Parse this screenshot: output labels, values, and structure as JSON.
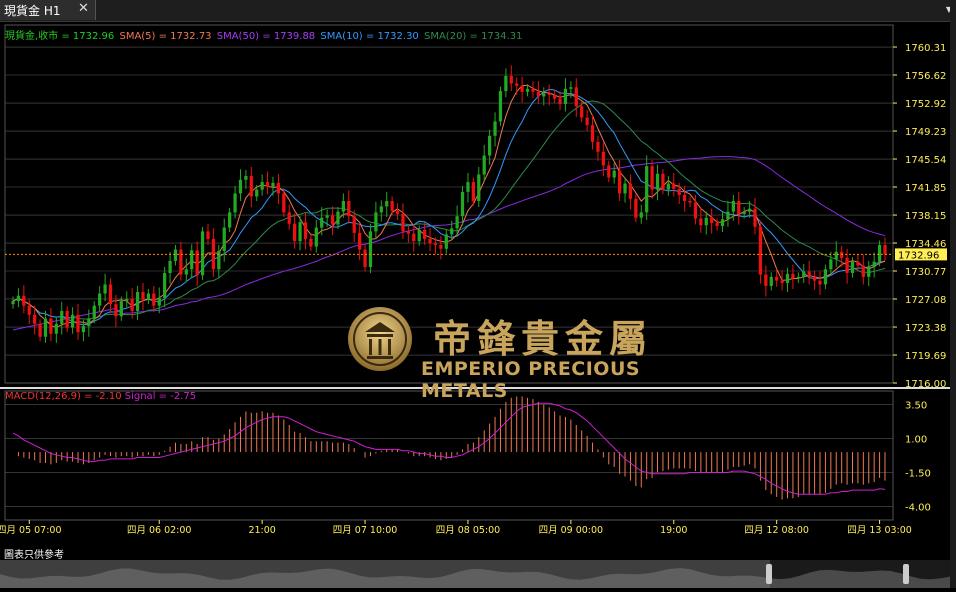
{
  "tab": {
    "title": "現貨金 H1",
    "close": "✕",
    "menu": "▼"
  },
  "legend": {
    "price": "現貨金,收市 = 1732.96",
    "sma5": "SMA(5) = 1732.73",
    "sma50": "SMA(50) = 1739.88",
    "sma10": "SMA(10) = 1732.30",
    "sma20": "SMA(20) = 1734.31"
  },
  "macd_legend": {
    "label": "MACD(12,26,9) = -2.10",
    "signal": "Signal = -2.75"
  },
  "current_price_label": "1732.96",
  "logo": {
    "chinese": "帝鋒貴金屬",
    "english": "EMPERIO PRECIOUS METALS"
  },
  "disclaimer": "圖表只供參考",
  "colors": {
    "bull": "#22aa22",
    "bear": "#ee1111",
    "sma5": "#f07850",
    "sma10": "#3399ff",
    "sma20": "#2d8a4e",
    "sma50": "#8a2be2",
    "macd_hist": "#f07850",
    "signal": "#d020d0",
    "axis_text": "#ffee55",
    "current_line": "#ff8c00",
    "gold": "#c9a45c"
  },
  "chart_data": [
    {
      "type": "candlestick",
      "title": "現貨金 H1",
      "yaxis_ticks": [
        1760.31,
        1756.62,
        1752.92,
        1749.23,
        1745.54,
        1741.85,
        1738.15,
        1734.46,
        1730.77,
        1727.08,
        1723.38,
        1719.69,
        1716.0
      ],
      "ylim": [
        1716.0,
        1761.5
      ],
      "xaxis_ticks": [
        "四月 05 07:00",
        "四月 06 02:00",
        "21:00",
        "四月 07 10:00",
        "四月 08 05:00",
        "四月 09 00:00",
        "19:00",
        "四月 12 08:00",
        "四月 13 03:00"
      ],
      "xtick_bar_index": [
        3,
        27,
        46,
        65,
        84,
        103,
        122,
        141,
        160
      ],
      "grid": true,
      "current_price": 1732.96,
      "series": [
        {
          "name": "現貨金",
          "close": [
            1726.8,
            1727.5,
            1726.2,
            1725.0,
            1723.8,
            1722.1,
            1724.5,
            1722.5,
            1723.8,
            1725.5,
            1723.3,
            1725.0,
            1722.7,
            1723.5,
            1724.5,
            1726.2,
            1727.8,
            1729.0,
            1726.4,
            1724.8,
            1726.8,
            1727.1,
            1725.5,
            1728.0,
            1727.0,
            1727.8,
            1726.2,
            1727.2,
            1730.5,
            1732.1,
            1733.6,
            1730.3,
            1731.0,
            1733.5,
            1730.2,
            1736.0,
            1735.0,
            1731.0,
            1733.4,
            1736.5,
            1738.5,
            1741.0,
            1742.8,
            1743.3,
            1740.6,
            1741.5,
            1742.5,
            1741.9,
            1742.4,
            1741.0,
            1738.5,
            1737.0,
            1734.7,
            1737.2,
            1735.0,
            1734.0,
            1736.5,
            1737.8,
            1738.1,
            1736.9,
            1738.6,
            1740.0,
            1738.0,
            1735.8,
            1733.6,
            1731.3,
            1736.0,
            1738.5,
            1739.3,
            1740.0,
            1738.7,
            1738.3,
            1736.0,
            1735.7,
            1734.7,
            1736.2,
            1735.0,
            1734.4,
            1734.2,
            1733.7,
            1735.6,
            1736.4,
            1738.0,
            1741.2,
            1742.5,
            1740.0,
            1743.5,
            1746.0,
            1748.6,
            1750.5,
            1754.5,
            1756.5,
            1755.5,
            1755.2,
            1754.4,
            1754.8,
            1754.4,
            1753.8,
            1754.2,
            1754.0,
            1753.5,
            1752.8,
            1754.8,
            1755.0,
            1752.5,
            1751.0,
            1750.0,
            1747.8,
            1746.5,
            1744.7,
            1743.1,
            1744.0,
            1741.0,
            1742.3,
            1740.3,
            1737.8,
            1738.5,
            1744.6,
            1741.5,
            1743.6,
            1741.5,
            1742.3,
            1741.6,
            1740.8,
            1740.0,
            1739.8,
            1737.7,
            1736.8,
            1737.8,
            1737.1,
            1736.7,
            1737.6,
            1738.6,
            1740.0,
            1738.3,
            1738.6,
            1739.0,
            1736.6,
            1730.3,
            1728.8,
            1730.0,
            1729.5,
            1729.2,
            1730.4,
            1729.8,
            1730.0,
            1730.7,
            1730.0,
            1729.5,
            1729.0,
            1731.0,
            1732.3,
            1733.3,
            1732.5,
            1730.5,
            1732.0,
            1731.5,
            1730.0,
            1731.3,
            1732.0,
            1734.2,
            1732.96
          ]
        }
      ],
      "overlays": [
        "SMA(5)",
        "SMA(10)",
        "SMA(20)",
        "SMA(50)"
      ]
    },
    {
      "type": "bar",
      "title": "MACD(12,26,9)",
      "yaxis_ticks": [
        3.5,
        1.0,
        -1.5,
        -4.0
      ],
      "ylim": [
        -5.0,
        4.5
      ],
      "grid": true,
      "series": [
        {
          "name": "MACD",
          "values": [
            0.0,
            -0.3,
            -0.4,
            -0.5,
            -0.6,
            -0.8,
            -0.8,
            -0.9,
            -0.8,
            -0.6,
            -0.7,
            -0.7,
            -0.8,
            -0.9,
            -0.8,
            -0.6,
            -0.4,
            -0.2,
            -0.3,
            -0.4,
            -0.3,
            -0.3,
            -0.4,
            -0.3,
            -0.3,
            -0.2,
            -0.3,
            -0.2,
            0.1,
            0.4,
            0.7,
            0.6,
            0.6,
            0.8,
            0.6,
            1.1,
            1.1,
            0.9,
            1.0,
            1.3,
            1.7,
            2.2,
            2.6,
            3.0,
            2.9,
            2.9,
            3.0,
            2.9,
            2.9,
            2.7,
            2.4,
            2.0,
            1.5,
            1.4,
            1.1,
            0.8,
            0.8,
            0.8,
            0.8,
            0.7,
            0.7,
            0.7,
            0.6,
            0.3,
            0.0,
            -0.4,
            -0.3,
            -0.1,
            0.1,
            0.2,
            0.2,
            0.2,
            0.0,
            -0.1,
            -0.3,
            -0.3,
            -0.3,
            -0.4,
            -0.5,
            -0.6,
            -0.5,
            -0.4,
            -0.2,
            0.2,
            0.6,
            0.7,
            1.1,
            1.6,
            2.1,
            2.6,
            3.2,
            3.7,
            4.0,
            4.1,
            4.1,
            4.0,
            3.9,
            3.7,
            3.5,
            3.3,
            3.0,
            2.7,
            2.6,
            2.4,
            2.0,
            1.6,
            1.2,
            0.7,
            0.2,
            -0.4,
            -0.9,
            -1.1,
            -1.6,
            -1.8,
            -2.1,
            -2.5,
            -2.6,
            -2.0,
            -1.9,
            -1.5,
            -1.4,
            -1.3,
            -1.2,
            -1.2,
            -1.2,
            -1.2,
            -1.4,
            -1.5,
            -1.5,
            -1.5,
            -1.5,
            -1.5,
            -1.3,
            -1.1,
            -1.1,
            -1.0,
            -0.9,
            -1.2,
            -2.1,
            -2.8,
            -3.1,
            -3.3,
            -3.5,
            -3.4,
            -3.4,
            -3.3,
            -3.1,
            -3.1,
            -3.1,
            -3.1,
            -3.0,
            -2.7,
            -2.4,
            -2.3,
            -2.4,
            -2.3,
            -2.3,
            -2.4,
            -2.3,
            -2.2,
            -1.9,
            -2.1
          ]
        },
        {
          "name": "Signal",
          "values": [
            1.4,
            1.2,
            0.9,
            0.7,
            0.5,
            0.3,
            0.1,
            -0.1,
            -0.2,
            -0.3,
            -0.4,
            -0.4,
            -0.5,
            -0.6,
            -0.7,
            -0.7,
            -0.6,
            -0.6,
            -0.5,
            -0.5,
            -0.5,
            -0.5,
            -0.5,
            -0.4,
            -0.4,
            -0.4,
            -0.4,
            -0.4,
            -0.3,
            -0.2,
            -0.1,
            0.0,
            0.1,
            0.2,
            0.3,
            0.4,
            0.5,
            0.6,
            0.7,
            0.8,
            1.0,
            1.2,
            1.5,
            1.8,
            2.0,
            2.2,
            2.4,
            2.5,
            2.6,
            2.6,
            2.6,
            2.5,
            2.3,
            2.1,
            1.9,
            1.7,
            1.5,
            1.4,
            1.3,
            1.2,
            1.1,
            1.0,
            0.9,
            0.8,
            0.6,
            0.4,
            0.3,
            0.2,
            0.2,
            0.2,
            0.2,
            0.2,
            0.1,
            0.1,
            0.0,
            -0.1,
            -0.1,
            -0.2,
            -0.3,
            -0.3,
            -0.4,
            -0.4,
            -0.3,
            -0.2,
            0.0,
            0.2,
            0.4,
            0.7,
            1.0,
            1.4,
            1.8,
            2.2,
            2.6,
            3.0,
            3.3,
            3.4,
            3.5,
            3.6,
            3.6,
            3.6,
            3.5,
            3.4,
            3.2,
            3.1,
            2.9,
            2.6,
            2.3,
            1.9,
            1.5,
            1.1,
            0.7,
            0.3,
            -0.1,
            -0.5,
            -0.8,
            -1.1,
            -1.4,
            -1.5,
            -1.6,
            -1.6,
            -1.6,
            -1.6,
            -1.6,
            -1.6,
            -1.6,
            -1.5,
            -1.5,
            -1.5,
            -1.5,
            -1.5,
            -1.5,
            -1.5,
            -1.5,
            -1.4,
            -1.4,
            -1.4,
            -1.5,
            -1.6,
            -1.8,
            -2.0,
            -2.3,
            -2.5,
            -2.7,
            -2.9,
            -3.0,
            -3.1,
            -3.1,
            -3.1,
            -3.1,
            -3.1,
            -3.1,
            -3.0,
            -3.0,
            -2.9,
            -2.9,
            -2.8,
            -2.8,
            -2.8,
            -2.8,
            -2.8,
            -2.7,
            -2.75
          ]
        }
      ]
    }
  ]
}
